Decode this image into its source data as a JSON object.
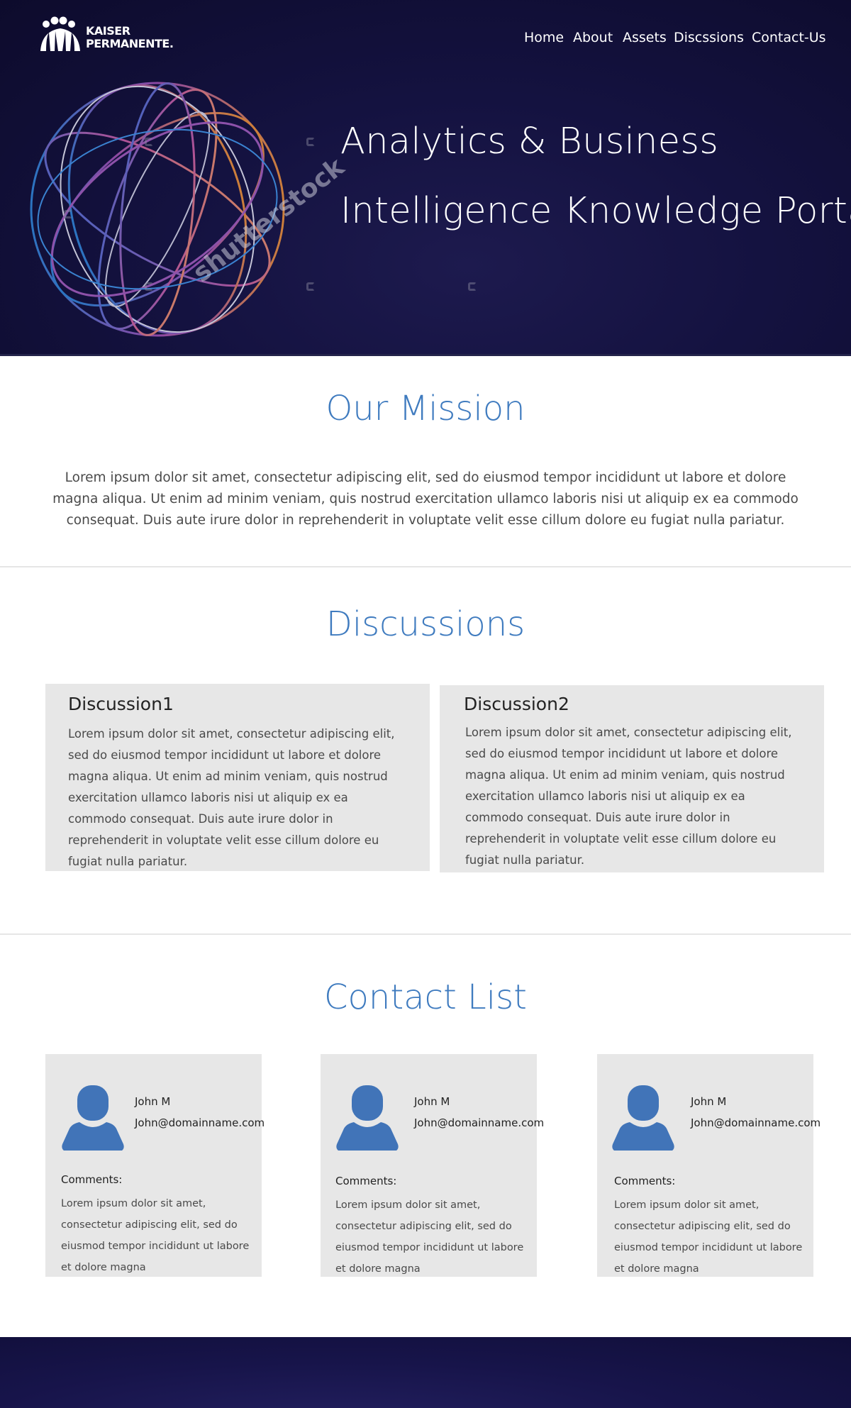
{
  "brand": {
    "line1": "KAISER",
    "line2": "PERMANENTE."
  },
  "nav": {
    "items": [
      "Home",
      "About",
      "Assets",
      "Discssions",
      "Contact-Us"
    ]
  },
  "hero": {
    "title_line1": "Analytics & Business",
    "title_line2": "Intelligence Knowledge Portal",
    "watermark": "shutterstock"
  },
  "mission": {
    "title": "Our Mission",
    "text": "Lorem ipsum dolor sit amet, consectetur adipiscing elit, sed do eiusmod tempor incididunt ut labore et dolore magna aliqua. Ut enim ad minim veniam, quis nostrud exercitation ullamco laboris nisi ut aliquip ex ea commodo consequat. Duis aute irure dolor in reprehenderit in voluptate velit esse cillum dolore eu fugiat nulla pariatur."
  },
  "discussions": {
    "title": "Discussions",
    "items": [
      {
        "title": "Discussion1",
        "body": "Lorem ipsum dolor sit amet, consectetur adipiscing elit, sed do eiusmod tempor incididunt ut labore et dolore magna aliqua. Ut enim ad minim veniam, quis nostrud exercitation ullamco laboris nisi ut aliquip ex ea commodo consequat. Duis aute irure dolor in reprehenderit in voluptate velit esse cillum dolore eu fugiat nulla pariatur."
      },
      {
        "title": "Discussion2",
        "body": "Lorem ipsum dolor sit amet, consectetur adipiscing elit, sed do eiusmod tempor incididunt ut labore et dolore magna aliqua. Ut enim ad minim veniam, quis nostrud exercitation ullamco laboris nisi ut aliquip ex ea commodo consequat. Duis aute irure dolor in reprehenderit in voluptate velit esse cillum dolore eu fugiat nulla pariatur."
      }
    ]
  },
  "contacts": {
    "title": "Contact List",
    "items": [
      {
        "name": "John M",
        "email": "John@domainname.com",
        "comments_label": "Comments:",
        "comments": "Lorem ipsum dolor sit amet, consectetur adipiscing elit, sed do eiusmod tempor incididunt ut labore et dolore magna"
      },
      {
        "name": "John M",
        "email": "John@domainname.com",
        "comments_label": "Comments:",
        "comments": "Lorem ipsum dolor sit amet, consectetur adipiscing elit, sed do eiusmod tempor incididunt ut labore et dolore magna"
      },
      {
        "name": "John M",
        "email": "John@domainname.com",
        "comments_label": "Comments:",
        "comments": "Lorem ipsum dolor sit amet, consectetur adipiscing elit, sed do eiusmod tempor incididunt ut labore et dolore magna"
      }
    ]
  },
  "colors": {
    "accent": "#3f7bbf",
    "hero_bg": "#141240",
    "card_bg": "#e7e7e7",
    "avatar": "#4174b8"
  },
  "icons": {
    "logo": "kaiser-permanente-logo",
    "avatar": "user-avatar-icon"
  }
}
